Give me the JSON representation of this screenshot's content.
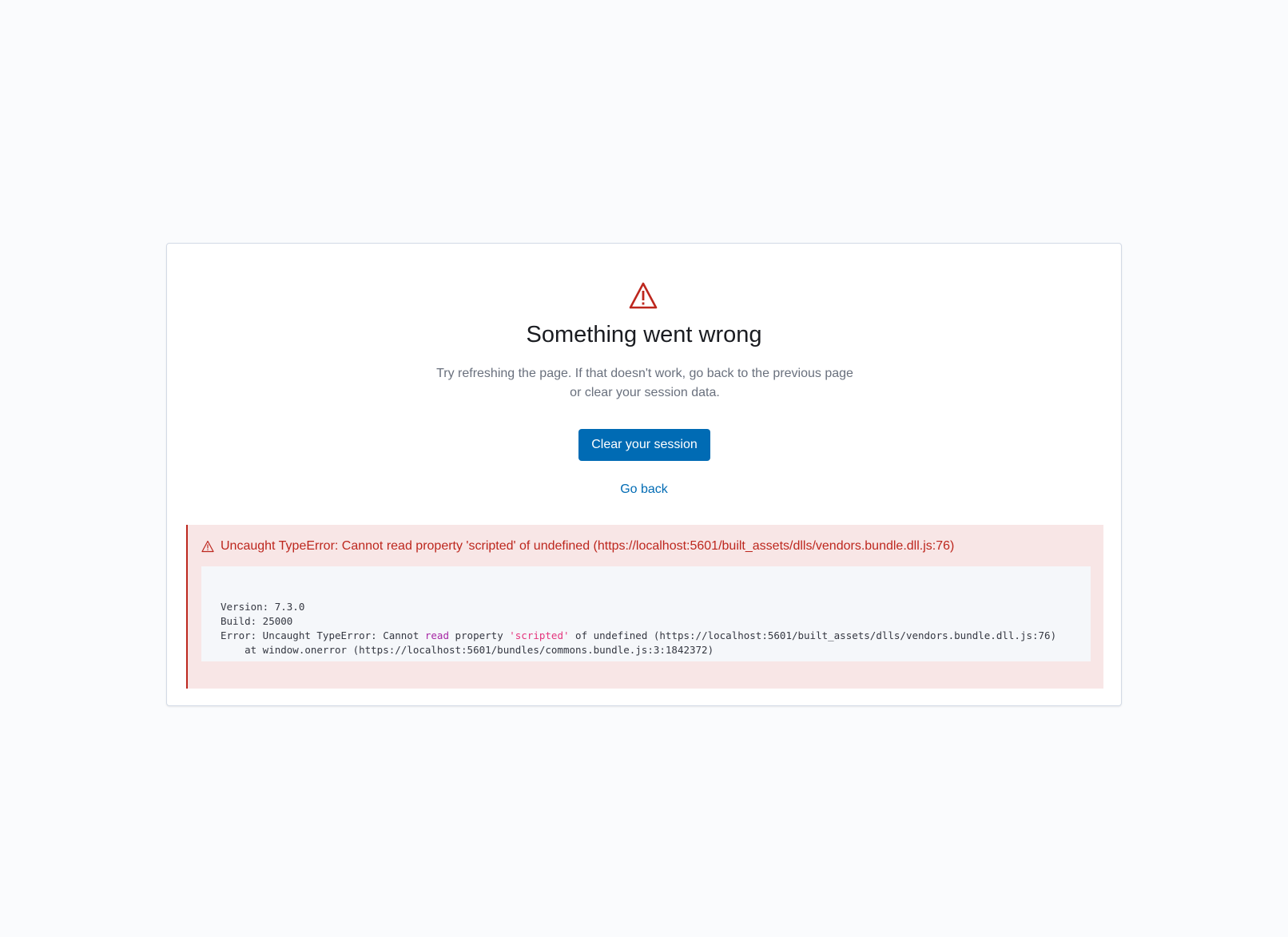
{
  "error_page": {
    "title": "Something went wrong",
    "description": "Try refreshing the page. If that doesn't work, go back to the previous page or clear your session data.",
    "clear_session_label": "Clear your session",
    "go_back_label": "Go back"
  },
  "error_callout": {
    "icon": "warning-icon",
    "message": "Uncaught TypeError: Cannot read property 'scripted' of undefined (https://localhost:5601/built_assets/dlls/vendors.bundle.dll.js:76)",
    "code": {
      "version_line": "Version: 7.3.0",
      "build_line": "Build: 25000",
      "error_prefix": "Error: Uncaught TypeError: Cannot ",
      "error_keyword": "read",
      "error_mid": " property ",
      "error_string": "'scripted'",
      "error_suffix": " of undefined (https://localhost:5601/built_assets/dlls/vendors.bundle.dll.js:76)",
      "stack_line": "    at window.onerror (https://localhost:5601/bundles/commons.bundle.js:3:1842372)"
    }
  },
  "colors": {
    "background": "#fafbfd",
    "danger": "#bd271e",
    "primary": "#006bb4",
    "callout_background": "#f8e6e6"
  }
}
